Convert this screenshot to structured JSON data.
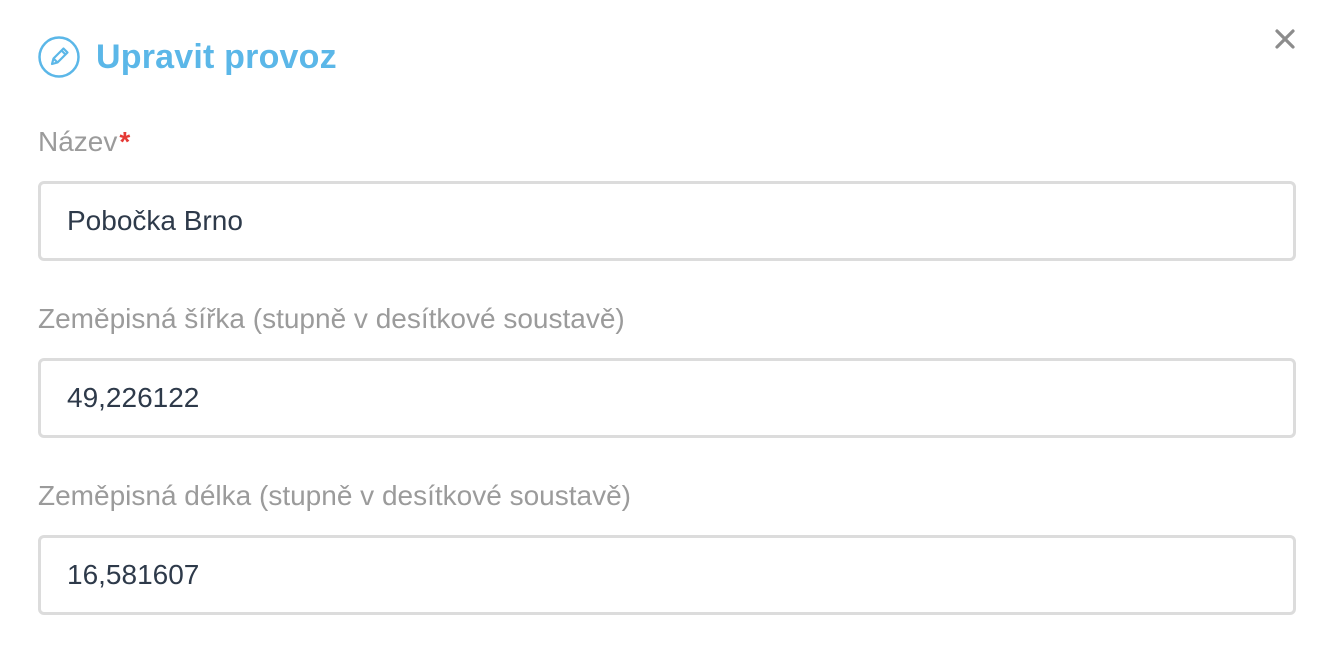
{
  "dialog": {
    "title": "Upravit provoz",
    "title_icon": "pencil-circle-icon",
    "close_icon": "close-icon",
    "accent_color": "#5bb7e8",
    "required_color": "#e53935"
  },
  "fields": {
    "name": {
      "label": "Název",
      "required_mark": "*",
      "value": "Pobočka Brno"
    },
    "latitude": {
      "label": "Zeměpisná šířka (stupně v desítkové soustavě)",
      "value": "49,226122"
    },
    "longitude": {
      "label": "Zeměpisná délka (stupně v desítkové soustavě)",
      "value": "16,581607"
    }
  }
}
